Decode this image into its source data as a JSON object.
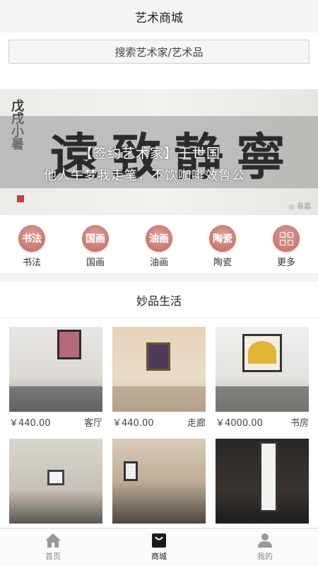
{
  "header": {
    "title": "艺术商城"
  },
  "search": {
    "placeholder": "搜索艺术家/艺术品"
  },
  "banner": {
    "heading": "【签约艺术家】王世国",
    "subtitle": "他人午梦我走笔，不饮咖啡效鲁公",
    "calligraphy": "遠致静寧",
    "side_inscription": "戊戌小暑",
    "watermark": "◎ 易嘉"
  },
  "categories": [
    {
      "icon_text": "书法",
      "label": "书法",
      "icon": "calligraphy-badge"
    },
    {
      "icon_text": "国画",
      "label": "国画",
      "icon": "chinese-painting-badge"
    },
    {
      "icon_text": "油画",
      "label": "油画",
      "icon": "oil-painting-badge"
    },
    {
      "icon_text": "陶瓷",
      "label": "陶瓷",
      "icon": "ceramics-badge"
    },
    {
      "icon_text": "",
      "label": "更多",
      "icon": "grid-icon"
    }
  ],
  "section": {
    "title": "妙品生活"
  },
  "products": [
    {
      "price": "￥440.00",
      "room": "客厅"
    },
    {
      "price": "￥440.00",
      "room": "走廊"
    },
    {
      "price": "￥4000.00",
      "room": "书房"
    },
    {
      "price": "",
      "room": ""
    },
    {
      "price": "",
      "room": ""
    },
    {
      "price": "",
      "room": ""
    }
  ],
  "tabbar": {
    "items": [
      {
        "label": "首页",
        "icon": "home-icon",
        "active": false
      },
      {
        "label": "商城",
        "icon": "shopping-bag-icon",
        "active": true
      },
      {
        "label": "我的",
        "icon": "user-icon",
        "active": false
      }
    ]
  },
  "colors": {
    "accent": "#c9776f",
    "background": "#f2f2f2",
    "tab_active": "#222222",
    "tab_inactive": "#999999"
  }
}
